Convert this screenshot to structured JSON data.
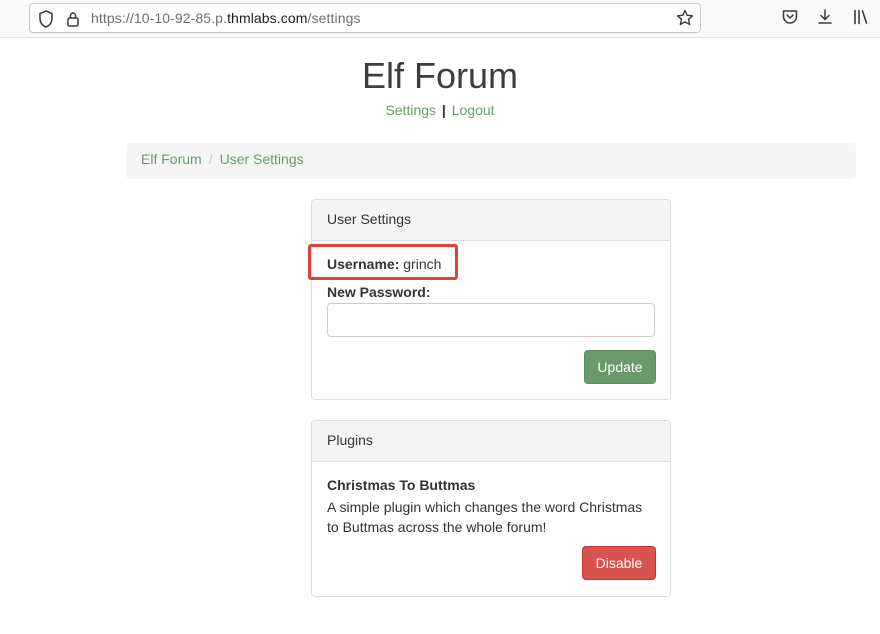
{
  "browser": {
    "url_prefix": "https://10-10-92-85.p.",
    "url_host": "thmlabs.com",
    "url_path": "/settings"
  },
  "site": {
    "title": "Elf Forum",
    "nav": {
      "settings": "Settings",
      "separator": "|",
      "logout": "Logout"
    }
  },
  "breadcrumb": {
    "home": "Elf Forum",
    "divider": "/",
    "current": "User Settings"
  },
  "user_settings": {
    "heading": "User Settings",
    "username_label": "Username:",
    "username_value": "grinch",
    "password_label": "New Password:",
    "password_value": "",
    "update_button": "Update"
  },
  "plugins": {
    "heading": "Plugins",
    "plugin_name": "Christmas To Buttmas",
    "plugin_description": "A simple plugin which changes the word Christmas to Buttmas across the whole forum!",
    "disable_button": "Disable"
  },
  "colors": {
    "accent_green": "#6a9a6a",
    "danger_red": "#d9534f",
    "highlight_red": "#d9443f"
  }
}
